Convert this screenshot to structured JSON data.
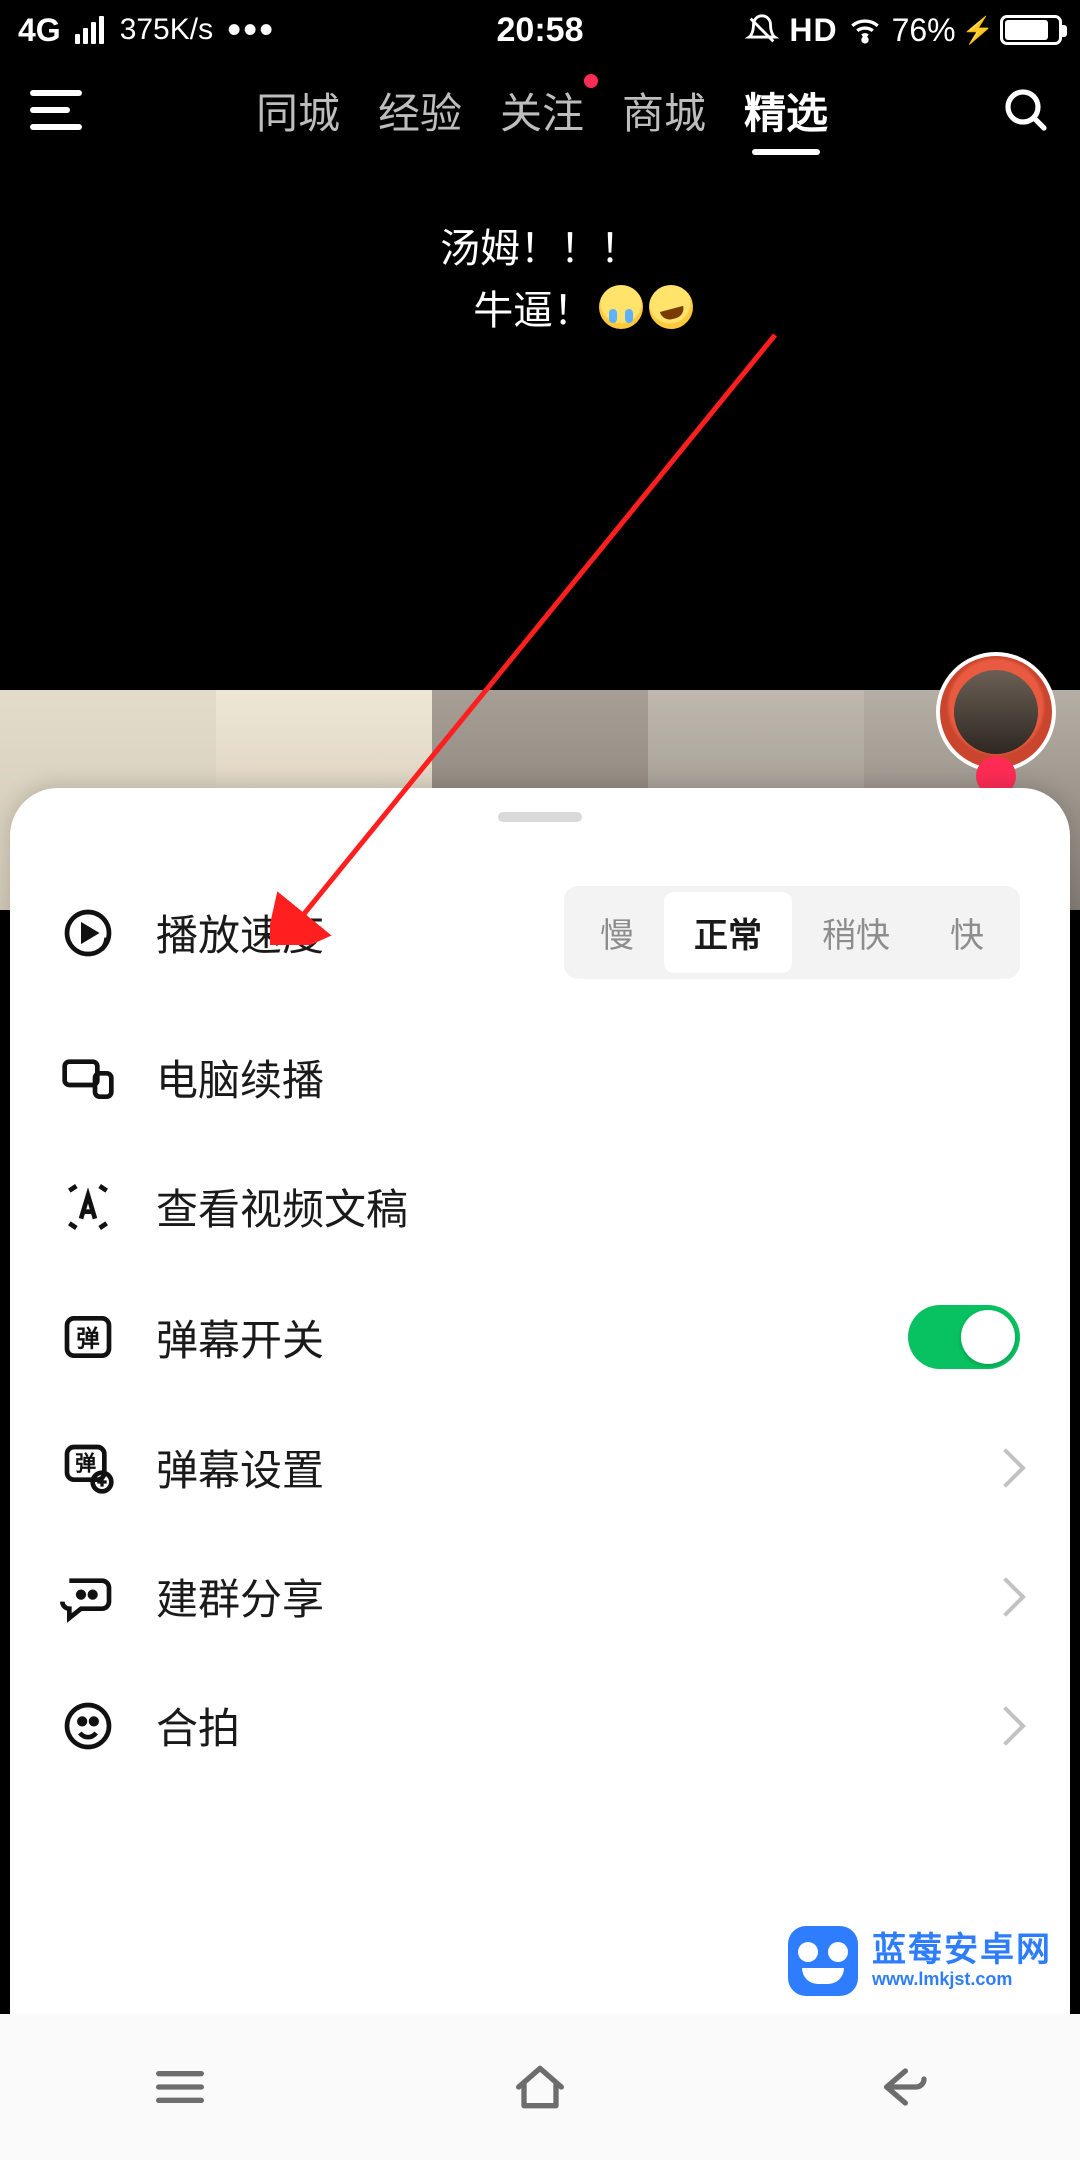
{
  "status": {
    "net_type": "4G",
    "speed": "375K/s",
    "time": "20:58",
    "hd": "HD",
    "battery_pct": "76%"
  },
  "nav": {
    "tabs": [
      {
        "label": "同城",
        "active": false,
        "dot": false
      },
      {
        "label": "经验",
        "active": false,
        "dot": false
      },
      {
        "label": "关注",
        "active": false,
        "dot": true
      },
      {
        "label": "商城",
        "active": false,
        "dot": false
      },
      {
        "label": "精选",
        "active": true,
        "dot": false
      }
    ]
  },
  "barrage": {
    "line1": "汤姆！！！",
    "line2": "牛逼！"
  },
  "sheet": {
    "speed": {
      "label": "播放速度",
      "options": [
        "慢",
        "正常",
        "稍快",
        "快"
      ],
      "selected_index": 1
    },
    "continue_pc": {
      "label": "电脑续播"
    },
    "transcript": {
      "label": "查看视频文稿"
    },
    "danmu_toggle": {
      "label": "弹幕开关",
      "on": true
    },
    "danmu_settings": {
      "label": "弹幕设置"
    },
    "group_share": {
      "label": "建群分享"
    },
    "duet": {
      "label": "合拍"
    }
  },
  "watermark": {
    "name": "蓝莓安卓网",
    "url": "www.lmkjst.com"
  }
}
